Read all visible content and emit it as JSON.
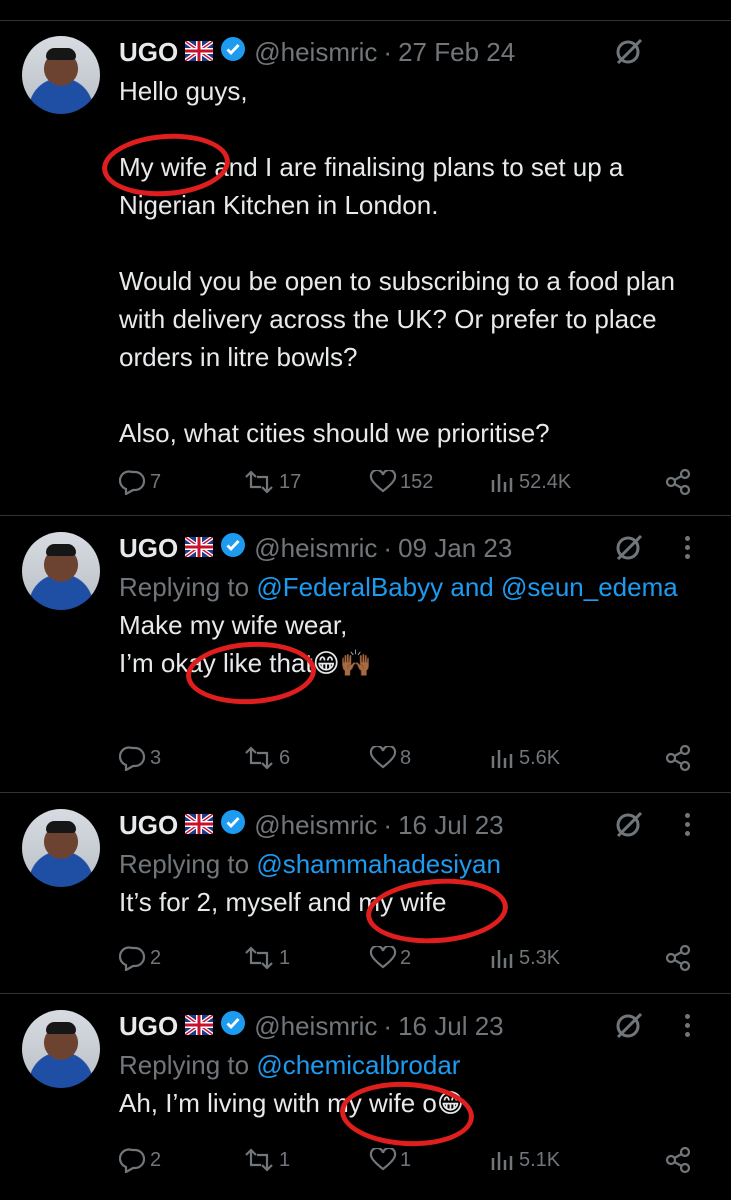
{
  "colors": {
    "background": "#000000",
    "text": "#e7e9ea",
    "muted": "#71767b",
    "link": "#1d9bf0",
    "annotation": "#e01e1e"
  },
  "tweets": [
    {
      "name": "UGO",
      "flag": "🇬🇧",
      "handle": "@heismric",
      "sep": "·",
      "date": "27 Feb 24",
      "reply_prefix": "",
      "reply_to": "",
      "reply_and": "",
      "reply_to2": "",
      "paragraphs": [
        "Hello guys,",
        "My wife and I are finalising plans to set up a Nigerian Kitchen in London.",
        "Would you be open to subscribing to a food plan with delivery across the UK? Or prefer to place orders in litre bowls?",
        "Also, what cities should we prioritise?"
      ],
      "replies": "7",
      "reposts": "17",
      "likes": "152",
      "views": "52.4K"
    },
    {
      "name": "UGO",
      "flag": "🇬🇧",
      "handle": "@heismric",
      "sep": "·",
      "date": "09 Jan 23",
      "reply_prefix": "Replying to",
      "reply_to": "@FederalBabyy",
      "reply_and": "and",
      "reply_to2": "@seun_edema",
      "paragraphs": [
        "Make my wife wear,",
        "I’m okay like that😁🙌🏾"
      ],
      "replies": "3",
      "reposts": "6",
      "likes": "8",
      "views": "5.6K"
    },
    {
      "name": "UGO",
      "flag": "🇬🇧",
      "handle": "@heismric",
      "sep": "·",
      "date": "16 Jul 23",
      "reply_prefix": "Replying to",
      "reply_to": "@shammahadesiyan",
      "reply_and": "",
      "reply_to2": "",
      "paragraphs": [
        "It’s for 2, myself and my wife"
      ],
      "replies": "2",
      "reposts": "1",
      "likes": "2",
      "views": "5.3K"
    },
    {
      "name": "UGO",
      "flag": "🇬🇧",
      "handle": "@heismric",
      "sep": "·",
      "date": "16 Jul 23",
      "reply_prefix": "Replying to",
      "reply_to": "@chemicalbrodar",
      "reply_and": "",
      "reply_to2": "",
      "paragraphs": [
        "Ah, I’m living with my wife o😁"
      ],
      "replies": "2",
      "reposts": "1",
      "likes": "1",
      "views": "5.1K"
    }
  ]
}
